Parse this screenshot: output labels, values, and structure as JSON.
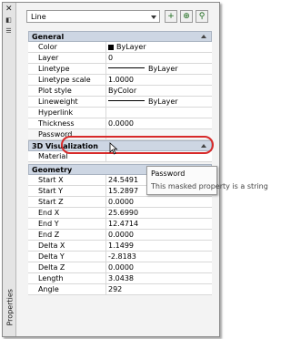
{
  "panel": {
    "title": "Properties",
    "selector": "Line"
  },
  "sections": {
    "general": "General",
    "visualization": "3D Visualization",
    "geometry": "Geometry"
  },
  "general": [
    {
      "label": "Color",
      "value": "ByLayer"
    },
    {
      "label": "Layer",
      "value": "0"
    },
    {
      "label": "Linetype",
      "value": "ByLayer"
    },
    {
      "label": "Linetype scale",
      "value": "1.0000"
    },
    {
      "label": "Plot style",
      "value": "ByColor"
    },
    {
      "label": "Lineweight",
      "value": "ByLayer"
    },
    {
      "label": "Hyperlink",
      "value": ""
    },
    {
      "label": "Thickness",
      "value": "0.0000"
    },
    {
      "label": "Password",
      "value": ""
    }
  ],
  "visualization": [
    {
      "label": "Material",
      "value": ""
    }
  ],
  "geometry": [
    {
      "label": "Start X",
      "value": "24.5491"
    },
    {
      "label": "Start Y",
      "value": "15.2897"
    },
    {
      "label": "Start Z",
      "value": "0.0000"
    },
    {
      "label": "End X",
      "value": "25.6990"
    },
    {
      "label": "End Y",
      "value": "12.4714"
    },
    {
      "label": "End Z",
      "value": "0.0000"
    },
    {
      "label": "Delta X",
      "value": "1.1499"
    },
    {
      "label": "Delta Y",
      "value": "-2.8183"
    },
    {
      "label": "Delta Z",
      "value": "0.0000"
    },
    {
      "label": "Length",
      "value": "3.0438"
    },
    {
      "label": "Angle",
      "value": "292"
    }
  ],
  "tooltip": {
    "title": "Password",
    "text": "This masked property is a string"
  }
}
